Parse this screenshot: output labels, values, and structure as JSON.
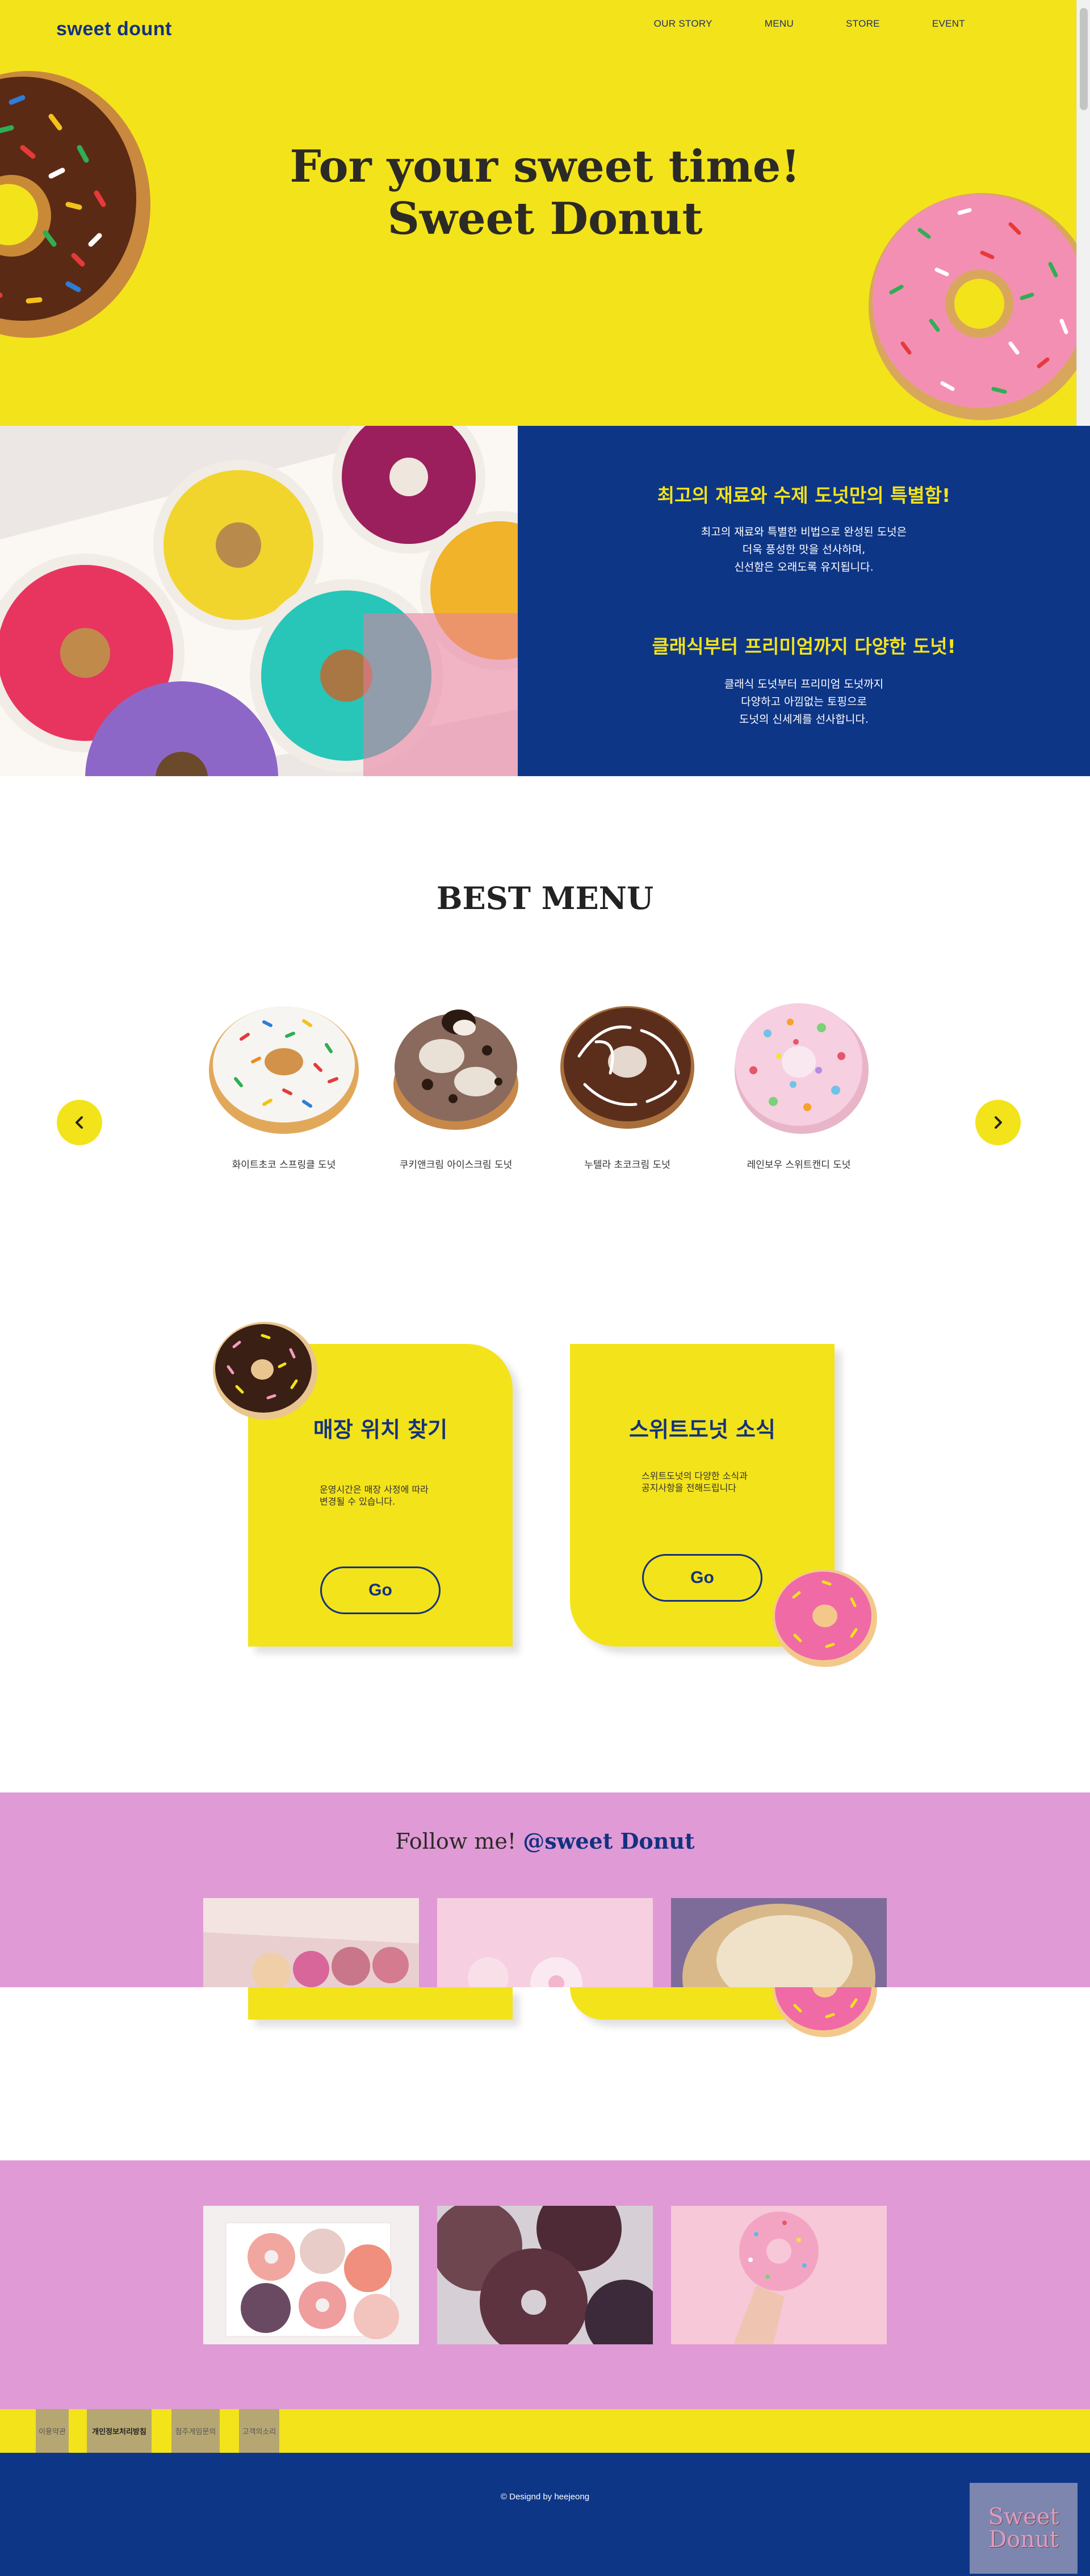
{
  "header": {
    "logo": "sweet dount",
    "nav": [
      "OUR STORY",
      "MENU",
      "STORE",
      "EVENT"
    ]
  },
  "hero": {
    "title_line1": "For your sweet time!",
    "title_line2": "Sweet Donut"
  },
  "intro": {
    "heading1": "최고의 재료와 수제 도넛만의 특별함!",
    "body1": "최고의 재료와 특별한 비법으로 완성된 도넛은\n더욱 풍성한 맛을 선사하며,\n신선함은 오래도록 유지됩니다.",
    "heading2": "클래식부터 프리미엄까지 다양한 도넛!",
    "body2": "클래식 도넛부터 프리미엄 도넛까지\n다양하고 아낌없는 토핑으로\n도넛의 신세계를 선사합니다."
  },
  "best_menu": {
    "title": "BEST MENU",
    "items": [
      {
        "name": "화이트초코 스프링클 도넛",
        "icon": "white-sprinkle-donut"
      },
      {
        "name": "쿠키앤크림 아이스크림 도넛",
        "icon": "cookies-cream-donut"
      },
      {
        "name": "누텔라 초코크림 도넛",
        "icon": "nutella-donut"
      },
      {
        "name": "레인보우 스위트캔디 도넛",
        "icon": "rainbow-candy-donut"
      }
    ],
    "prev_icon": "chevron-left-icon",
    "next_icon": "chevron-right-icon"
  },
  "cards": {
    "store": {
      "title": "매장 위치 찾기",
      "desc": "운영시간은 매장 사정에 따라\n변경될 수 있습니다.",
      "button": "Go"
    },
    "news": {
      "title": "스위트도넛 소식",
      "desc": "스위트도넛의 다양한 소식과\n공지사항을 전해드립니다",
      "button": "Go"
    }
  },
  "follow": {
    "prefix": "Follow me! ",
    "handle": "@sweet Donut"
  },
  "footer": {
    "links": [
      "이용약관",
      "개인정보처리방침",
      "점주게임문의",
      "고객의소리"
    ],
    "copyright": "© Designd by heejeong",
    "badge_line1": "Sweet",
    "badge_line2": "Donut"
  },
  "colors": {
    "yellow": "#f3e31b",
    "navy": "#0e3687",
    "pink_band": "#e09ad6"
  }
}
